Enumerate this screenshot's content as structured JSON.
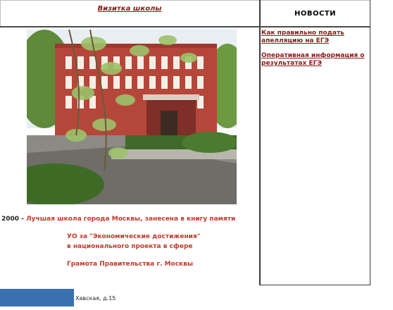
{
  "header": {
    "left_link": "Визитка школы",
    "right_title": "НОВОСТИ"
  },
  "news": {
    "items": [
      "Как правильно подать апелляцию на ЕГЭ",
      "Оперативная информация о результатах ЕГЭ"
    ]
  },
  "achievements": [
    {
      "prefix": "2000 -",
      "text": "Лучшая школа города Москвы, занесена в книгу памяти"
    },
    {
      "prefix": "",
      "text": "УО за \"Экономические достижения\""
    },
    {
      "prefix": "",
      "text": "в национального проекта в сфере"
    },
    {
      "prefix": "",
      "text": "Грамота Правительства г. Москвы"
    }
  ],
  "footer": {
    "address": "Хавская, д.15"
  },
  "colors": {
    "link": "#8a1a1a",
    "achievement": "#c0392b",
    "footer_block": "#3a6fb0"
  }
}
